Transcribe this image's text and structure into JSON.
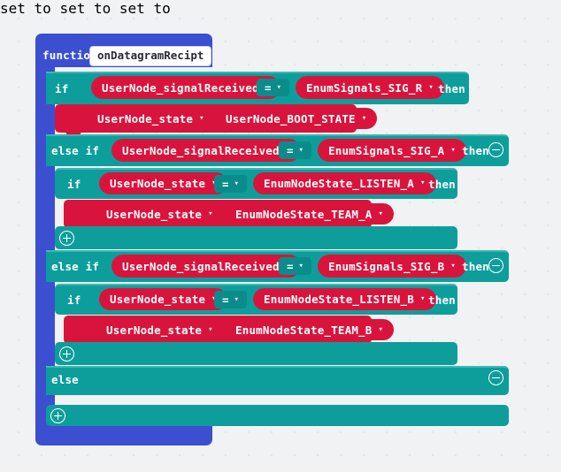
{
  "workspace": {
    "type": "blockly-visual-programming-workspace",
    "background_color": "#f1f2f4"
  },
  "colors": {
    "function_block": "#3b4fd0",
    "logic_block": "#0d9e9c",
    "variable_block": "#d9143c",
    "operator_block": "#0b8c8b",
    "text_on_block": "#ffffff",
    "field_background": "#ffffff"
  },
  "function_block": {
    "keyword": "function",
    "name_field_value": "onDatagramRecipt"
  },
  "statements": {
    "if_1": {
      "keyword": "if",
      "then_keyword": "then",
      "condition": {
        "left_operand": "UserNode_signalReceived",
        "operator": "=",
        "right_operand": "EnumSignals_SIG_R"
      },
      "body": {
        "set_keyword": "set",
        "variable": "UserNode_state",
        "to_keyword": "to",
        "value": "UserNode_BOOT_STATE"
      }
    },
    "else_if_1": {
      "keyword": "else if",
      "then_keyword": "then",
      "mutator_icon": "minus-circle-icon",
      "condition": {
        "left_operand": "UserNode_signalReceived",
        "operator": "=",
        "right_operand": "EnumSignals_SIG_A"
      },
      "nested_if": {
        "keyword": "if",
        "then_keyword": "then",
        "mutator_icon": "plus-circle-icon",
        "condition": {
          "left_operand": "UserNode_state",
          "operator": "=",
          "right_operand": "EnumNodeState_LISTEN_A"
        },
        "body": {
          "set_keyword": "set",
          "variable": "UserNode_state",
          "to_keyword": "to",
          "value": "EnumNodeState_TEAM_A"
        }
      }
    },
    "else_if_2": {
      "keyword": "else if",
      "then_keyword": "then",
      "mutator_icon": "minus-circle-icon",
      "condition": {
        "left_operand": "UserNode_signalReceived",
        "operator": "=",
        "right_operand": "EnumSignals_SIG_B"
      },
      "nested_if": {
        "keyword": "if",
        "then_keyword": "then",
        "mutator_icon": "plus-circle-icon",
        "condition": {
          "left_operand": "UserNode_state",
          "operator": "=",
          "right_operand": "EnumNodeState_LISTEN_B"
        },
        "body": {
          "set_keyword": "set",
          "variable": "UserNode_state",
          "to_keyword": "to",
          "value": "EnumNodeState_TEAM_B"
        }
      }
    },
    "else_clause": {
      "keyword": "else",
      "mutator_icon": "minus-circle-icon",
      "body": ""
    },
    "outer_mutator_icon": "plus-circle-icon"
  },
  "dropdown_caret": "▾",
  "operator_caret": "▾"
}
